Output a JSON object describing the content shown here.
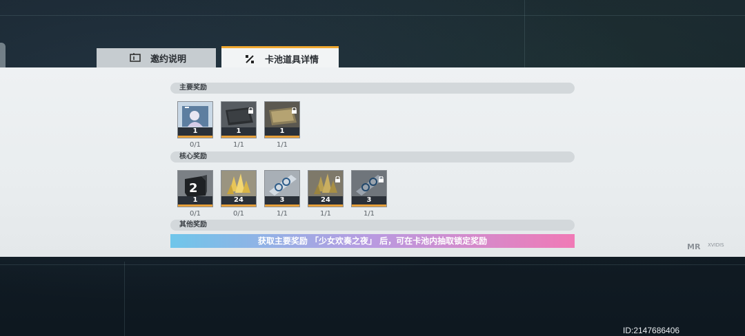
{
  "tabs": [
    {
      "label": "邀约说明",
      "icon": "info-book-icon",
      "active": false
    },
    {
      "label": "卡池道具详情",
      "icon": "percent-icon",
      "active": true
    }
  ],
  "sections": {
    "main": {
      "title": "主要奖励",
      "items": [
        {
          "name": "character-portrait-card",
          "count": "1",
          "progress": "0/1",
          "locked": false
        },
        {
          "name": "dark-keyboard-item",
          "count": "1",
          "progress": "1/1",
          "locked": true
        },
        {
          "name": "gold-keyboard-item",
          "count": "1",
          "progress": "1/1",
          "locked": true
        }
      ]
    },
    "core": {
      "title": "核心奖励",
      "items": [
        {
          "name": "level-2-box-item",
          "count": "1",
          "progress": "0/1",
          "locked": false
        },
        {
          "name": "gold-crystal-item",
          "count": "24",
          "progress": "0/1",
          "locked": false
        },
        {
          "name": "blue-ticket-item",
          "count": "3",
          "progress": "1/1",
          "locked": false
        },
        {
          "name": "gold-crystal-item-locked",
          "count": "24",
          "progress": "1/1",
          "locked": true
        },
        {
          "name": "blue-ticket-item-locked",
          "count": "3",
          "progress": "1/1",
          "locked": true
        }
      ]
    },
    "other": {
      "title": "其他奖励"
    }
  },
  "banner": "获取主要奖励 「少女欢奏之夜」 后，可在卡池内抽取锁定奖励",
  "logos": {
    "left": "MR",
    "right": "XVIDIS"
  },
  "footer_id": "ID:2147686406",
  "colors": {
    "accent": "#f0a830",
    "rarity": "#e8a13a",
    "banner_start": "#6fc6ea",
    "banner_end": "#f07ab6"
  }
}
